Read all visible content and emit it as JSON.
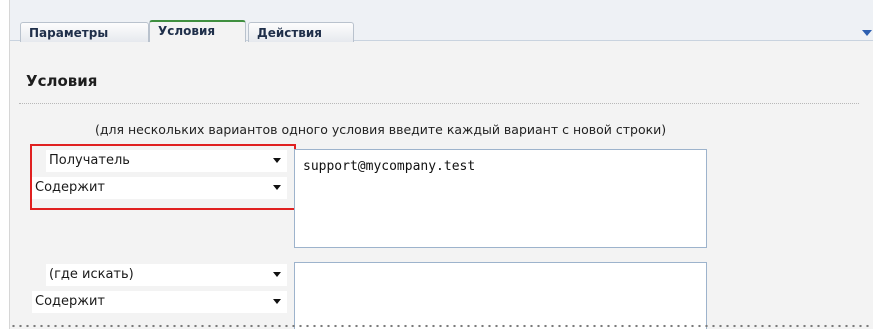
{
  "tabs": [
    {
      "label": "Параметры"
    },
    {
      "label": "Условия"
    },
    {
      "label": "Действия"
    }
  ],
  "section": {
    "title": "Условия"
  },
  "hint": "(для нескольких вариантов одного условия введите каждый вариант с новой строки)",
  "conditions": [
    {
      "field": "Получатель",
      "operator": "Содержит",
      "value": "support@mycompany.test"
    },
    {
      "field": "(где искать)",
      "operator": "Содержит",
      "value": ""
    }
  ]
}
